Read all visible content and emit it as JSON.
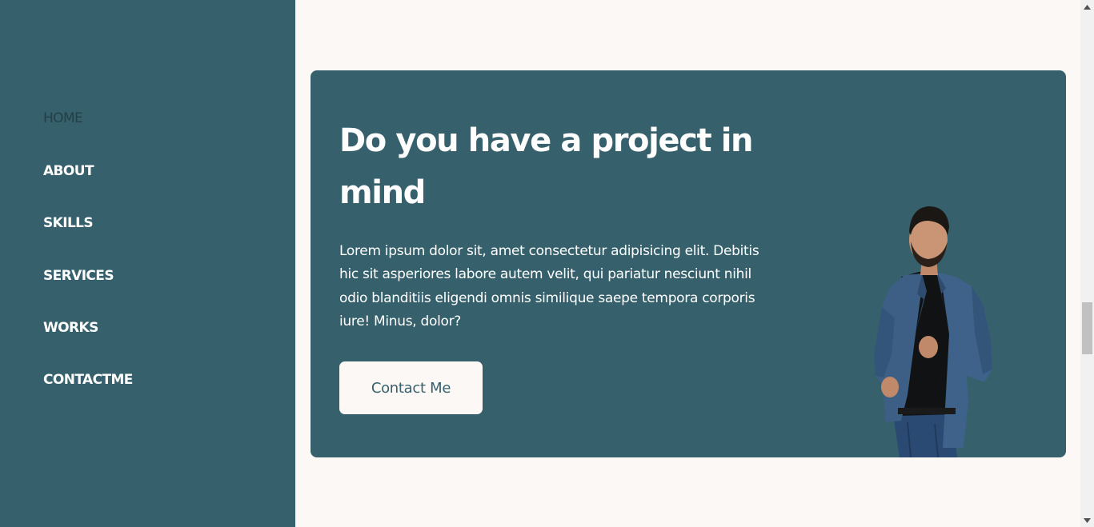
{
  "sidebar": {
    "nav_items": [
      {
        "label": "HOME",
        "active": true
      },
      {
        "label": "ABOUT",
        "active": false
      },
      {
        "label": "SKILLS",
        "active": false
      },
      {
        "label": "SERVICES",
        "active": false
      },
      {
        "label": "WORKS",
        "active": false
      },
      {
        "label": "CONTACTME",
        "active": false
      }
    ]
  },
  "cta": {
    "title": "Do you have a project in mind",
    "text": "Lorem ipsum dolor sit, amet consectetur adipisicing elit. Debitis hic sit asperiores labore autem velit, qui pariatur nesciunt nihil odio blanditiis eligendi omnis similique saepe tempora corporis iure! Minus, dolor?",
    "button_label": "Contact Me",
    "image": "person-photo"
  },
  "colors": {
    "primary": "#35606c",
    "background": "#fcf8f6",
    "active_nav": "#243f47",
    "text_light": "#ffffff"
  },
  "icons": {
    "scroll_up": "triangle-up-icon",
    "scroll_down": "triangle-down-icon"
  }
}
